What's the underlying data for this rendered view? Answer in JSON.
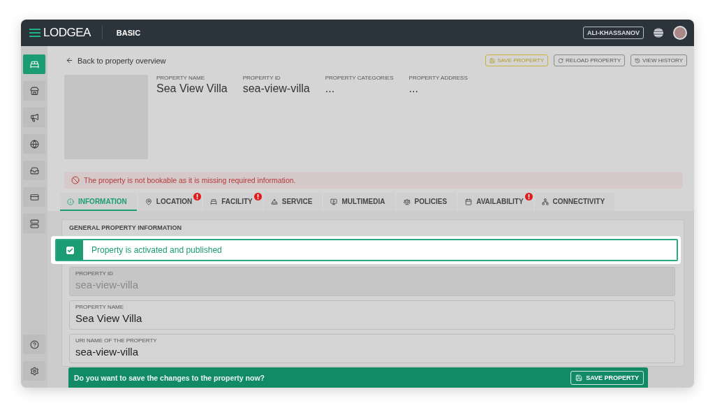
{
  "brand": {
    "logo": "LODGEA",
    "plan": "BASIC"
  },
  "user": {
    "name": "ALI-KHASSANOV"
  },
  "sidebar": {
    "items": [
      {
        "kind": "bed",
        "selected": true
      },
      {
        "kind": "store",
        "selected": false
      },
      {
        "kind": "megaphone",
        "selected": false
      },
      {
        "kind": "globe",
        "selected": false
      },
      {
        "kind": "inbox",
        "selected": false
      },
      {
        "kind": "card",
        "selected": false
      },
      {
        "kind": "server",
        "selected": false
      }
    ],
    "bottom": [
      {
        "kind": "help"
      },
      {
        "kind": "settings"
      }
    ]
  },
  "back_link": "Back to property overview",
  "actions": [
    {
      "label": "SAVE PROPERTY",
      "kind": "save"
    },
    {
      "label": "RELOAD PROPERTY",
      "kind": "reload"
    },
    {
      "label": "VIEW HISTORY",
      "kind": "history"
    }
  ],
  "summary": [
    {
      "label": "PROPERTY NAME",
      "value": "Sea View Villa"
    },
    {
      "label": "PROPERTY ID",
      "value": "sea-view-villa"
    },
    {
      "label": "PROPERTY CATEGORIES",
      "value": "..."
    },
    {
      "label": "PROPERTY ADDRESS",
      "value": "..."
    }
  ],
  "alert": "The property is not bookable as it is missing required information.",
  "tabs": [
    {
      "label": "INFORMATION",
      "kind": "info",
      "selected": true,
      "warning": false
    },
    {
      "label": "LOCATION",
      "kind": "location",
      "selected": false,
      "warning": true
    },
    {
      "label": "FACILITY",
      "kind": "facility",
      "selected": false,
      "warning": true
    },
    {
      "label": "SERVICE",
      "kind": "service",
      "selected": false,
      "warning": false
    },
    {
      "label": "MULTIMEDIA",
      "kind": "multimedia",
      "selected": false,
      "warning": false
    },
    {
      "label": "POLICIES",
      "kind": "policies",
      "selected": false,
      "warning": false
    },
    {
      "label": "AVAILABILITY",
      "kind": "availability",
      "selected": false,
      "warning": true
    },
    {
      "label": "CONNECTIVITY",
      "kind": "connectivity",
      "selected": false,
      "warning": false
    }
  ],
  "section": {
    "title": "GENERAL PROPERTY INFORMATION"
  },
  "status": {
    "text": "Property is activated and published",
    "checked": true
  },
  "fields": [
    {
      "label": "PROPERTY ID",
      "value": "sea-view-villa",
      "disabled": true
    },
    {
      "label": "PROPERTY NAME",
      "value": "Sea View Villa",
      "disabled": false
    },
    {
      "label": "URI NAME OF THE PROPERTY",
      "value": "sea-view-villa",
      "disabled": false
    }
  ],
  "save_bar": {
    "text": "Do you want to save the changes to the property now?",
    "button": "SAVE PROPERTY"
  }
}
